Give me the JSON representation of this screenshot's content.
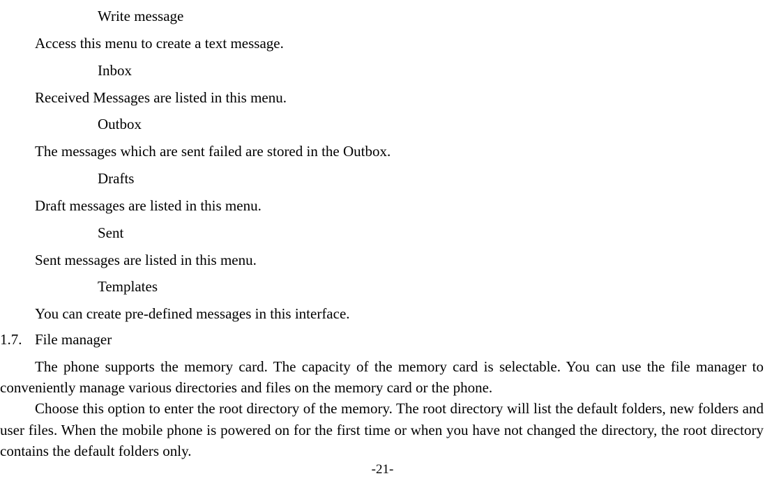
{
  "items": [
    {
      "heading": "Write message",
      "desc": "Access this menu to create a text message."
    },
    {
      "heading": "Inbox",
      "desc": "Received Messages are listed in this menu."
    },
    {
      "heading": "Outbox",
      "desc": "The messages which are sent failed are stored in the Outbox."
    },
    {
      "heading": "Drafts",
      "desc": "Draft messages are listed in this menu."
    },
    {
      "heading": "Sent",
      "desc": "Sent messages are listed in this menu."
    },
    {
      "heading": "Templates",
      "desc": "You can create pre-defined messages in this interface."
    }
  ],
  "section": {
    "number": "1.7.",
    "title": "File manager"
  },
  "paragraphs": [
    "The phone supports the memory card. The capacity of the memory card is selectable. You can use the file manager to conveniently manage various directories and files on the memory card or the phone.",
    "Choose this option to enter the root directory of the memory. The root directory will list the default folders, new folders and user files. When the mobile phone is powered on for the first time or when you have not changed the directory, the root directory contains the default folders only."
  ],
  "page_number": "-21-"
}
